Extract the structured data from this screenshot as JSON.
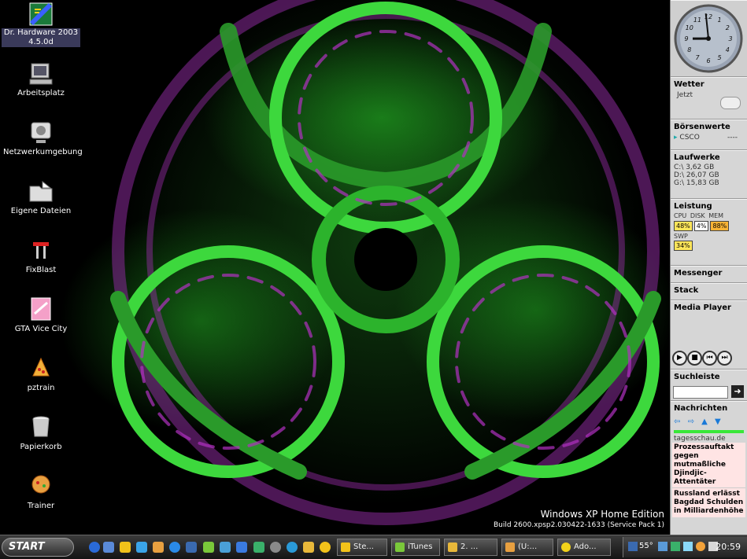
{
  "desktop": {
    "icons": [
      {
        "label": "Dr. Hardware 2003 4.5.0d",
        "icon": "dr-hardware-icon"
      },
      {
        "label": "Arbeitsplatz",
        "icon": "computer-icon"
      },
      {
        "label": "Netzwerkumgebung",
        "icon": "network-icon"
      },
      {
        "label": "Eigene Dateien",
        "icon": "documents-folder-icon"
      },
      {
        "label": "FixBlast",
        "icon": "tools-icon"
      },
      {
        "label": "GTA Vice City",
        "icon": "game-icon"
      },
      {
        "label": "pztrain",
        "icon": "pizza-icon"
      },
      {
        "label": "Papierkorb",
        "icon": "recycle-bin-icon"
      },
      {
        "label": "Trainer",
        "icon": "trainer-icon"
      }
    ],
    "watermark": {
      "line1": "Windows XP Home Edition",
      "line2": "Build 2600.xpsp2.030422-1633 (Service Pack 1)"
    }
  },
  "sidebar": {
    "clock": {
      "hour": 8,
      "minute": 59
    },
    "wetter": {
      "title": "Wetter",
      "now": "Jetzt"
    },
    "boerse": {
      "title": "Börsenwerte",
      "symbol": "CSCO",
      "value": "----"
    },
    "laufwerke": {
      "title": "Laufwerke",
      "drives": [
        "C:\\ 3,62 GB",
        "D:\\ 26,07 GB",
        "G:\\ 15,83 GB"
      ]
    },
    "leistung": {
      "title": "Leistung",
      "cpu_label": "CPU",
      "disk_label": "DISK",
      "mem_label": "MEM",
      "swp_label": "SWP",
      "cpu": "48%",
      "disk": "4%",
      "mem": "88%",
      "swp": "34%"
    },
    "messenger": {
      "title": "Messenger"
    },
    "stack": {
      "title": "Stack"
    },
    "media": {
      "title": "Media Player"
    },
    "suche": {
      "title": "Suchleiste",
      "placeholder": ""
    },
    "news": {
      "title": "Nachrichten",
      "source": "tagesschau.de",
      "item1": "Prozessauftakt gegen mutmaßliche Djindjic-Attentäter",
      "item2": "Russland erlässt Bagdad Schulden in Milliardenhöhe"
    }
  },
  "taskbar": {
    "start": "START",
    "buttons": [
      "Ste...",
      "iTunes",
      "2. ...",
      "(U:...",
      "Ado..."
    ],
    "temp": "55°",
    "time": "20:59"
  },
  "colors": {
    "accent": "#39e739",
    "magenta": "#b030c0",
    "news_bg": "#ffe4e4"
  }
}
